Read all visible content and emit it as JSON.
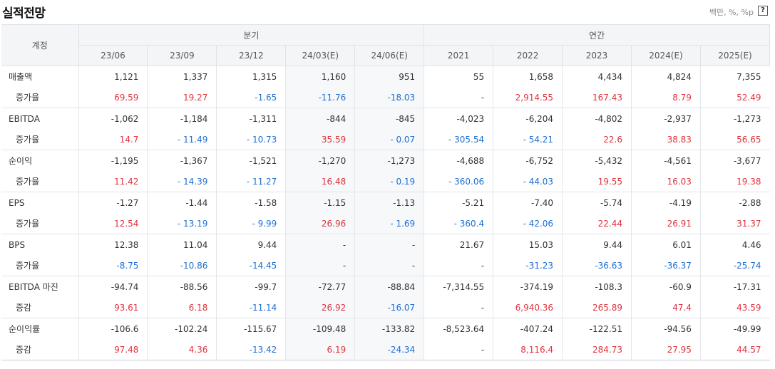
{
  "title": "실적전망",
  "unit": "백만, %, %p",
  "help_label": "?",
  "header": {
    "account_label": "계정",
    "quarter_group": "분기",
    "annual_group": "연간",
    "periods": [
      "23/06",
      "23/09",
      "23/12",
      "24/03(E)",
      "24/06(E)",
      "2021",
      "2022",
      "2023",
      "2024(E)",
      "2025(E)"
    ]
  },
  "rows": [
    {
      "label": "매출액",
      "sub": false,
      "values": [
        "1,121",
        "1,337",
        "1,315",
        "1,160",
        "951",
        "55",
        "1,658",
        "4,434",
        "4,824",
        "7,355"
      ]
    },
    {
      "label": "증가율",
      "sub": true,
      "values": [
        "69.59",
        "19.27",
        "-1.65",
        "-11.76",
        "-18.03",
        "-",
        "2,914.55",
        "167.43",
        "8.79",
        "52.49"
      ],
      "tones": [
        "pos",
        "pos",
        "neg",
        "neg",
        "neg",
        "neu",
        "pos",
        "pos",
        "pos",
        "pos"
      ]
    },
    {
      "label": "EBITDA",
      "sub": false,
      "values": [
        "-1,062",
        "-1,184",
        "-1,311",
        "-844",
        "-845",
        "-4,023",
        "-6,204",
        "-4,802",
        "-2,937",
        "-1,273"
      ]
    },
    {
      "label": "증가율",
      "sub": true,
      "values": [
        "14.7",
        "- 11.49",
        "- 10.73",
        "35.59",
        "- 0.07",
        "- 305.54",
        "- 54.21",
        "22.6",
        "38.83",
        "56.65"
      ],
      "tones": [
        "pos",
        "neg",
        "neg",
        "pos",
        "neg",
        "neg",
        "neg",
        "pos",
        "pos",
        "pos"
      ]
    },
    {
      "label": "순이익",
      "sub": false,
      "values": [
        "-1,195",
        "-1,367",
        "-1,521",
        "-1,270",
        "-1,273",
        "-4,688",
        "-6,752",
        "-5,432",
        "-4,561",
        "-3,677"
      ]
    },
    {
      "label": "증가율",
      "sub": true,
      "values": [
        "11.42",
        "- 14.39",
        "- 11.27",
        "16.48",
        "- 0.19",
        "- 360.06",
        "- 44.03",
        "19.55",
        "16.03",
        "19.38"
      ],
      "tones": [
        "pos",
        "neg",
        "neg",
        "pos",
        "neg",
        "neg",
        "neg",
        "pos",
        "pos",
        "pos"
      ]
    },
    {
      "label": "EPS",
      "sub": false,
      "values": [
        "-1.27",
        "-1.44",
        "-1.58",
        "-1.15",
        "-1.13",
        "-5.21",
        "-7.40",
        "-5.74",
        "-4.19",
        "-2.88"
      ]
    },
    {
      "label": "증가율",
      "sub": true,
      "values": [
        "12.54",
        "- 13.19",
        "- 9.99",
        "26.96",
        "- 1.69",
        "- 360.4",
        "- 42.06",
        "22.44",
        "26.91",
        "31.37"
      ],
      "tones": [
        "pos",
        "neg",
        "neg",
        "pos",
        "neg",
        "neg",
        "neg",
        "pos",
        "pos",
        "pos"
      ]
    },
    {
      "label": "BPS",
      "sub": false,
      "values": [
        "12.38",
        "11.04",
        "9.44",
        "-",
        "-",
        "21.67",
        "15.03",
        "9.44",
        "6.01",
        "4.46"
      ]
    },
    {
      "label": "증가율",
      "sub": true,
      "values": [
        "-8.75",
        "-10.86",
        "-14.45",
        "-",
        "-",
        "-",
        "-31.23",
        "-36.63",
        "-36.37",
        "-25.74"
      ],
      "tones": [
        "neg",
        "neg",
        "neg",
        "neu",
        "neu",
        "neu",
        "neg",
        "neg",
        "neg",
        "neg"
      ]
    },
    {
      "label": "EBITDA 마진",
      "sub": false,
      "values": [
        "-94.74",
        "-88.56",
        "-99.7",
        "-72.77",
        "-88.84",
        "-7,314.55",
        "-374.19",
        "-108.3",
        "-60.9",
        "-17.31"
      ]
    },
    {
      "label": "증감",
      "sub": true,
      "values": [
        "93.61",
        "6.18",
        "-11.14",
        "26.92",
        "-16.07",
        "-",
        "6,940.36",
        "265.89",
        "47.4",
        "43.59"
      ],
      "tones": [
        "pos",
        "pos",
        "neg",
        "pos",
        "neg",
        "neu",
        "pos",
        "pos",
        "pos",
        "pos"
      ]
    },
    {
      "label": "순이익률",
      "sub": false,
      "values": [
        "-106.6",
        "-102.24",
        "-115.67",
        "-109.48",
        "-133.82",
        "-8,523.64",
        "-407.24",
        "-122.51",
        "-94.56",
        "-49.99"
      ]
    },
    {
      "label": "증감",
      "sub": true,
      "values": [
        "97.48",
        "4.36",
        "-13.42",
        "6.19",
        "-24.34",
        "-",
        "8,116.4",
        "284.73",
        "27.95",
        "44.57"
      ],
      "tones": [
        "pos",
        "pos",
        "neg",
        "pos",
        "neg",
        "neu",
        "pos",
        "pos",
        "pos",
        "pos"
      ]
    }
  ],
  "colors": {
    "positive": "#e0333f",
    "negative": "#1f6fd1",
    "header_bg": "#f4f5f7",
    "estimate_bg": "#f7f8fa"
  }
}
